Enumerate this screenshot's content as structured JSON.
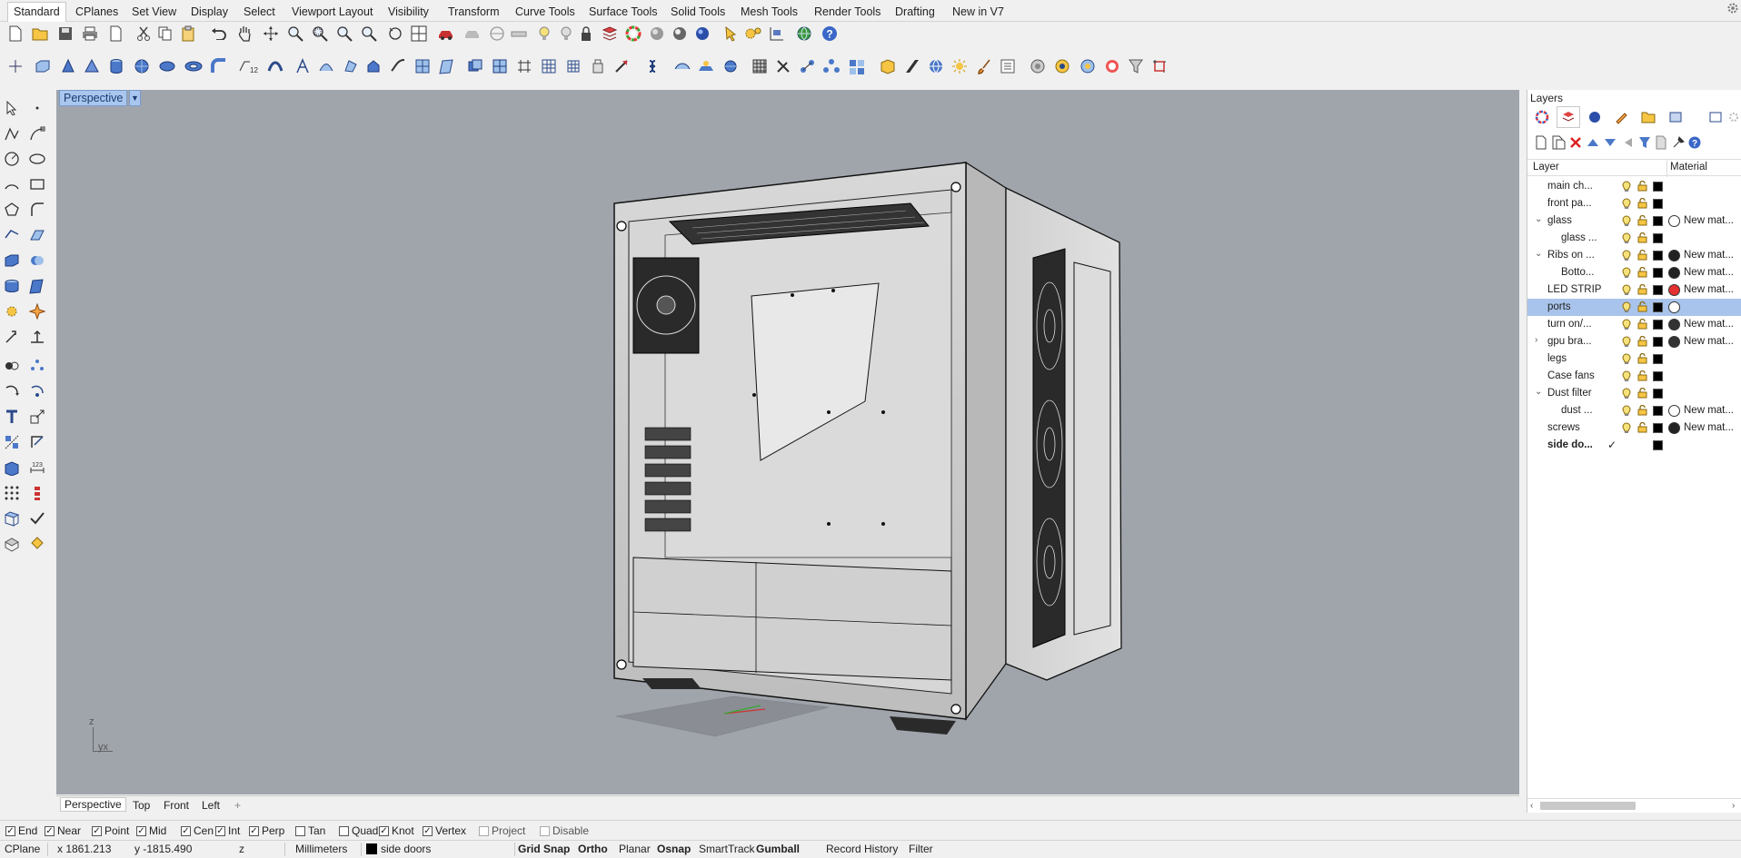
{
  "menu_tabs": [
    "Standard",
    "CPlanes",
    "Set View",
    "Display",
    "Select",
    "Viewport Layout",
    "Visibility",
    "Transform",
    "Curve Tools",
    "Surface Tools",
    "Solid Tools",
    "Mesh Tools",
    "Render Tools",
    "Drafting",
    "New in V7"
  ],
  "viewport": {
    "title": "Perspective",
    "axis_z": "z",
    "axis_yx": "yx"
  },
  "viewport_tabs": [
    "Perspective",
    "Top",
    "Front",
    "Left"
  ],
  "viewport_tab_add": "+",
  "layers_panel": {
    "title": "Layers",
    "col_layer": "Layer",
    "col_material": "Material",
    "rows": [
      {
        "name": "main ch...",
        "indent": 0,
        "expander": "",
        "material": "",
        "swatch": "",
        "selected": false
      },
      {
        "name": "front pa...",
        "indent": 0,
        "expander": "",
        "material": "",
        "swatch": "",
        "selected": false
      },
      {
        "name": "glass",
        "indent": 0,
        "expander": "v",
        "material": "New mat...",
        "swatch": "#ffffff",
        "selected": false
      },
      {
        "name": "glass ...",
        "indent": 1,
        "expander": "",
        "material": "",
        "swatch": "",
        "selected": false
      },
      {
        "name": "Ribs on ...",
        "indent": 0,
        "expander": "v",
        "material": "New mat...",
        "swatch": "#222222",
        "selected": false
      },
      {
        "name": "Botto...",
        "indent": 1,
        "expander": "",
        "material": "New mat...",
        "swatch": "#222222",
        "selected": false
      },
      {
        "name": "LED STRIP",
        "indent": 0,
        "expander": "",
        "material": "New mat...",
        "swatch": "#e53030",
        "selected": false
      },
      {
        "name": "ports",
        "indent": 0,
        "expander": "",
        "material": "",
        "swatch": "#ffffff",
        "selected": true
      },
      {
        "name": "turn on/...",
        "indent": 0,
        "expander": "",
        "material": "New mat...",
        "swatch": "#333333",
        "selected": false
      },
      {
        "name": "gpu bra...",
        "indent": 0,
        "expander": ">",
        "material": "New mat...",
        "swatch": "#333333",
        "selected": false
      },
      {
        "name": "legs",
        "indent": 0,
        "expander": "",
        "material": "",
        "swatch": "",
        "selected": false
      },
      {
        "name": "Case fans",
        "indent": 0,
        "expander": "",
        "material": "",
        "swatch": "",
        "selected": false
      },
      {
        "name": "Dust filter",
        "indent": 0,
        "expander": "v",
        "material": "",
        "swatch": "",
        "selected": false
      },
      {
        "name": "dust ...",
        "indent": 1,
        "expander": "",
        "material": "New mat...",
        "swatch": "#ffffff",
        "selected": false
      },
      {
        "name": "screws",
        "indent": 0,
        "expander": "",
        "material": "New mat...",
        "swatch": "#222222",
        "selected": false
      },
      {
        "name": "side do...",
        "indent": 0,
        "expander": "",
        "material": "",
        "swatch": "",
        "selected": false,
        "current": true,
        "check": "✓"
      }
    ]
  },
  "osnaps": [
    {
      "label": "End",
      "checked": true
    },
    {
      "label": "Near",
      "checked": true
    },
    {
      "label": "Point",
      "checked": true
    },
    {
      "label": "Mid",
      "checked": true
    },
    {
      "label": "Cen",
      "checked": true
    },
    {
      "label": "Int",
      "checked": true
    },
    {
      "label": "Perp",
      "checked": true
    },
    {
      "label": "Tan",
      "checked": false
    },
    {
      "label": "Quad",
      "checked": false
    },
    {
      "label": "Knot",
      "checked": true
    },
    {
      "label": "Vertex",
      "checked": true
    },
    {
      "label": "Project",
      "checked": false,
      "disabled": true
    },
    {
      "label": "Disable",
      "checked": false,
      "disabled": true
    }
  ],
  "status": {
    "cplane": "CPlane",
    "x": "x 1861.213",
    "y": "y -1815.490",
    "z": "z",
    "units": "Millimeters",
    "layer": "side doors",
    "toggles": [
      {
        "label": "Grid Snap",
        "on": true
      },
      {
        "label": "Ortho",
        "on": true
      },
      {
        "label": "Planar",
        "on": false
      },
      {
        "label": "Osnap",
        "on": true
      },
      {
        "label": "SmartTrack",
        "on": false
      },
      {
        "label": "Gumball",
        "on": true
      },
      {
        "label": "Record History",
        "on": false
      },
      {
        "label": "Filter",
        "on": false
      }
    ]
  },
  "colors": {
    "viewport_bg": "#a0a5ac",
    "selection": "#a9c4ec",
    "accent": "#1a3a70"
  }
}
